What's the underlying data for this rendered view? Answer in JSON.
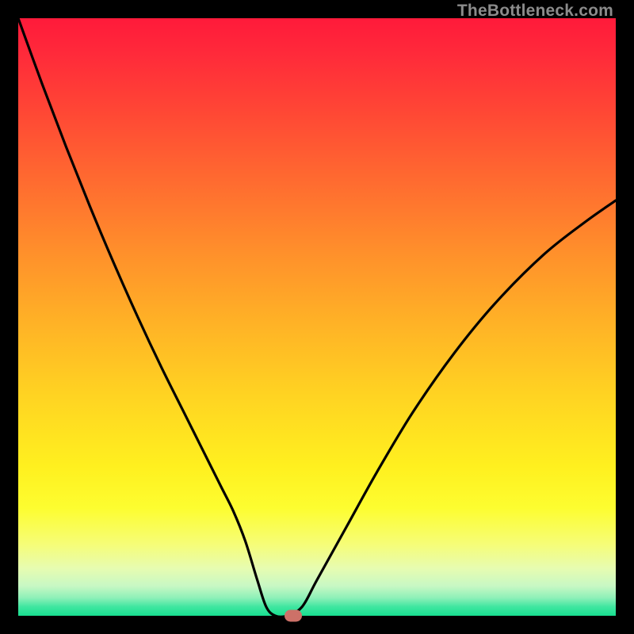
{
  "watermark": "TheBottleneck.com",
  "colors": {
    "curve": "#000000",
    "marker": "#cd7168",
    "frame": "#000000"
  },
  "chart_data": {
    "type": "line",
    "title": "",
    "xlabel": "",
    "ylabel": "",
    "xlim": [
      0,
      100
    ],
    "ylim": [
      0,
      100
    ],
    "series": [
      {
        "name": "bottleneck-curve",
        "x": [
          0.0,
          4.0,
          8.0,
          12.0,
          16.0,
          20.0,
          24.0,
          28.0,
          32.0,
          34.0,
          36.0,
          38.0,
          40.0,
          41.5,
          43.0,
          45.0,
          47.5,
          50.0,
          55.0,
          60.0,
          66.0,
          73.0,
          80.0,
          88.0,
          95.0,
          100.0
        ],
        "y": [
          100.0,
          89.0,
          78.5,
          68.5,
          59.0,
          50.0,
          41.5,
          33.5,
          25.5,
          21.5,
          17.5,
          12.5,
          6.0,
          1.5,
          0.0,
          0.0,
          1.5,
          6.0,
          15.0,
          24.0,
          34.0,
          44.0,
          52.5,
          60.5,
          66.0,
          69.5
        ]
      }
    ],
    "marker": {
      "x": 46.0,
      "y": 0.0
    },
    "grid": false,
    "legend": false
  }
}
